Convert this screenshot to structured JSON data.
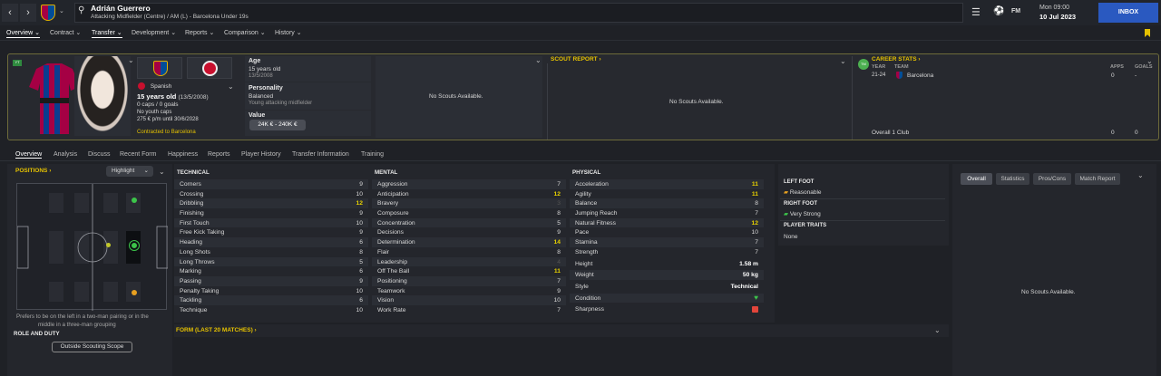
{
  "topbar": {
    "back_icon": "chevron-left-icon",
    "forward_icon": "chevron-right-icon",
    "player_name": "Adrián Guerrero",
    "player_subtitle": "Attacking Midfielder (Centre) / AM (L) - Barcelona Under 19s",
    "fm_label": "FM",
    "time": "Mon 09:00",
    "date": "10 Jul 2023",
    "inbox_label": "INBOX"
  },
  "nav": {
    "overview": "Overview",
    "contract": "Contract",
    "transfer": "Transfer",
    "development": "Development",
    "reports": "Reports",
    "comparison": "Comparison",
    "history": "History"
  },
  "profile": {
    "nationality": "Spanish",
    "age_line": "15 years old",
    "dob_short": "(13/5/2008)",
    "caps": "0 caps / 0 goals",
    "youth_caps": "No youth caps",
    "wage": "275 € p/m until 30/6/2028",
    "contracted": "Contracted to Barcelona"
  },
  "age_card": {
    "age_label": "Age",
    "age_value": "15 years old",
    "dob": "13/5/2008",
    "personality_label": "Personality",
    "personality_value": "Balanced",
    "personality_desc": "Young attacking midfielder",
    "value_label": "Value",
    "value_range": "24K € - 240K €"
  },
  "scouts_box": {
    "text": "No Scouts Available."
  },
  "scout_report": {
    "title": "SCOUT REPORT",
    "text": "No Scouts Available."
  },
  "career": {
    "title": "CAREER STATS",
    "col_year": "YEAR",
    "col_team": "TEAM",
    "col_apps": "APPS",
    "col_goals": "GOALS",
    "row_year": "21-24",
    "row_team": "Barcelona",
    "row_apps": "0",
    "row_goals": "-",
    "total_label": "Overall 1 Club",
    "total_apps": "0",
    "total_goals": "0"
  },
  "subtabs": [
    "Overview",
    "Analysis",
    "Discuss",
    "Recent Form",
    "Happiness",
    "Reports",
    "Player History",
    "Transfer Information",
    "Training"
  ],
  "positions": {
    "title": "POSITIONS",
    "highlight_label": "Highlight",
    "preference_text_1": "Prefers to be on the left in a two-man pairing or in the",
    "preference_text_2": "middle in a three-man grouping",
    "role_title": "ROLE AND DUTY",
    "scope_button": "Outside Scouting Scope"
  },
  "technical": {
    "title": "TECHNICAL",
    "rows": [
      {
        "name": "Corners",
        "value": "9"
      },
      {
        "name": "Crossing",
        "value": "10"
      },
      {
        "name": "Dribbling",
        "value": "12"
      },
      {
        "name": "Finishing",
        "value": "9"
      },
      {
        "name": "First Touch",
        "value": "10"
      },
      {
        "name": "Free Kick Taking",
        "value": "9"
      },
      {
        "name": "Heading",
        "value": "6"
      },
      {
        "name": "Long Shots",
        "value": "8"
      },
      {
        "name": "Long Throws",
        "value": "5"
      },
      {
        "name": "Marking",
        "value": "6"
      },
      {
        "name": "Passing",
        "value": "9"
      },
      {
        "name": "Penalty Taking",
        "value": "10"
      },
      {
        "name": "Tackling",
        "value": "6"
      },
      {
        "name": "Technique",
        "value": "10"
      }
    ]
  },
  "mental": {
    "title": "MENTAL",
    "rows": [
      {
        "name": "Aggression",
        "value": "7"
      },
      {
        "name": "Anticipation",
        "value": "12"
      },
      {
        "name": "Bravery",
        "value": "3"
      },
      {
        "name": "Composure",
        "value": "8"
      },
      {
        "name": "Concentration",
        "value": "5"
      },
      {
        "name": "Decisions",
        "value": "9"
      },
      {
        "name": "Determination",
        "value": "14"
      },
      {
        "name": "Flair",
        "value": "8"
      },
      {
        "name": "Leadership",
        "value": "4"
      },
      {
        "name": "Off The Ball",
        "value": "11"
      },
      {
        "name": "Positioning",
        "value": "7"
      },
      {
        "name": "Teamwork",
        "value": "9"
      },
      {
        "name": "Vision",
        "value": "10"
      },
      {
        "name": "Work Rate",
        "value": "7"
      }
    ]
  },
  "physical": {
    "title": "PHYSICAL",
    "rows": [
      {
        "name": "Acceleration",
        "value": "11"
      },
      {
        "name": "Agility",
        "value": "11"
      },
      {
        "name": "Balance",
        "value": "8"
      },
      {
        "name": "Jumping Reach",
        "value": "7"
      },
      {
        "name": "Natural Fitness",
        "value": "12"
      },
      {
        "name": "Pace",
        "value": "10"
      },
      {
        "name": "Stamina",
        "value": "7"
      },
      {
        "name": "Strength",
        "value": "7"
      }
    ],
    "height_label": "Height",
    "height_value": "1.58 m",
    "weight_label": "Weight",
    "weight_value": "50 kg",
    "style_label": "Style",
    "style_value": "Technical",
    "condition_label": "Condition",
    "sharpness_label": "Sharpness"
  },
  "feet": {
    "left_title": "LEFT FOOT",
    "left_value": "Reasonable",
    "right_title": "RIGHT FOOT",
    "right_value": "Very Strong",
    "traits_title": "PLAYER TRAITS",
    "traits_value": "None"
  },
  "form": {
    "title": "FORM (LAST 20 MATCHES)"
  },
  "right": {
    "tabs": [
      "Overall",
      "Statistics",
      "Pros/Cons",
      "Match Report"
    ],
    "text": "No Scouts Available."
  },
  "colors": {
    "accent": "#e6c200",
    "inbox": "#2a59c0",
    "highlight_value": "#e8d200"
  }
}
